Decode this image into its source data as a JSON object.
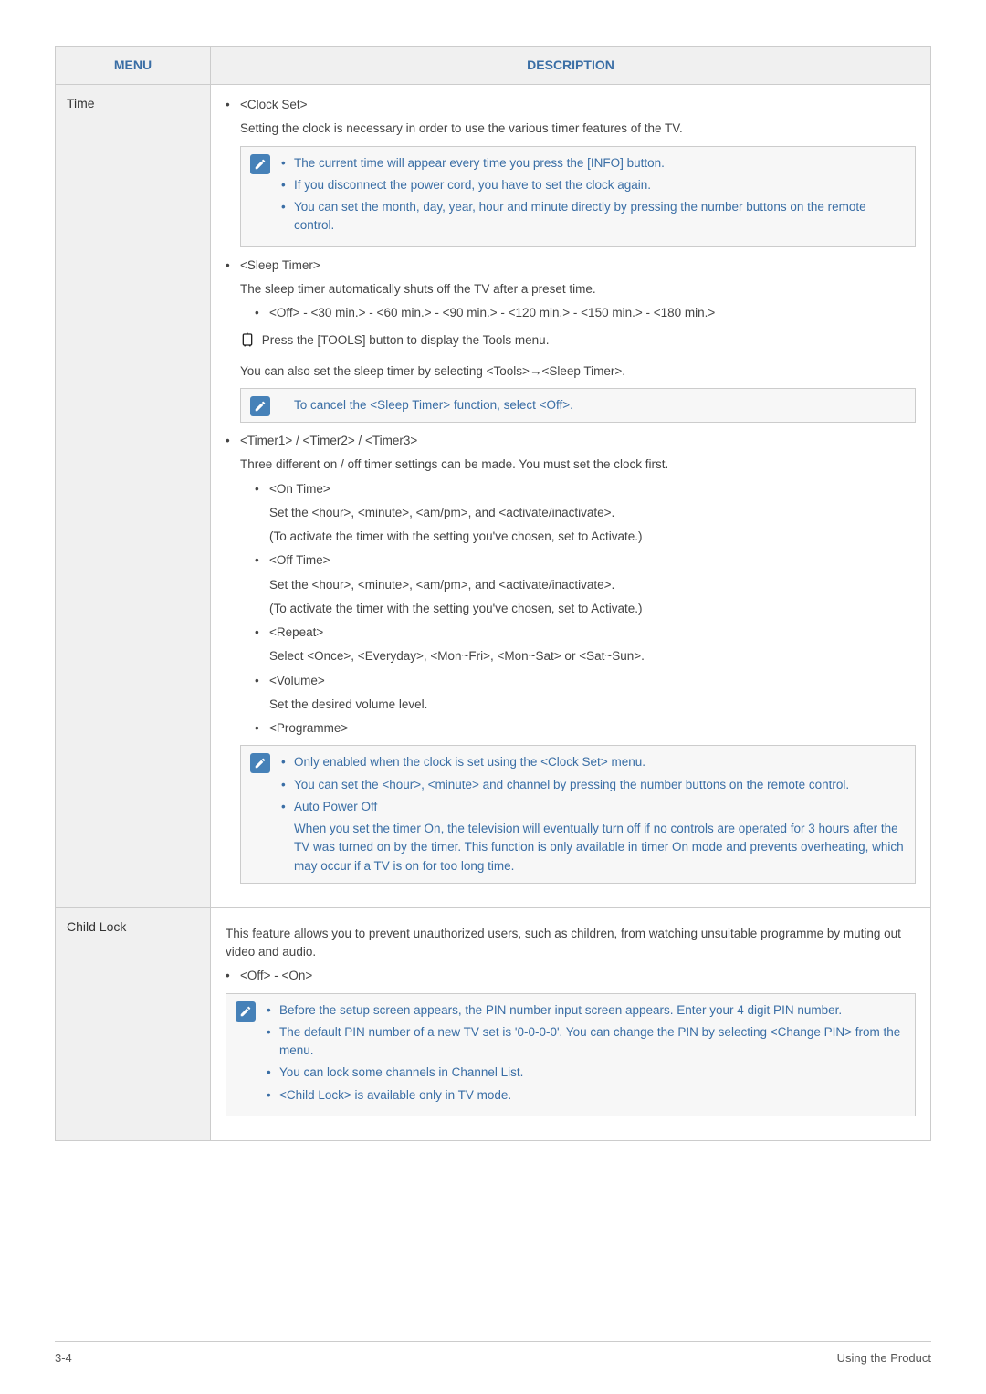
{
  "table": {
    "headers": {
      "menu": "MENU",
      "description": "DESCRIPTION"
    },
    "rows": [
      {
        "menu": "Time",
        "bullets": {
          "clock_set_title": "<Clock Set>",
          "clock_set_desc": "Setting the clock is necessary in order to use the various timer features of the TV.",
          "clock_note_1": "The current time will appear every time you press the [INFO] button.",
          "clock_note_2": "If you disconnect the power cord, you have to set the clock again.",
          "clock_note_3": "You can set the month, day, year, hour and minute directly by pressing the number buttons on the remote control.",
          "sleep_title": "<Sleep Timer>",
          "sleep_desc": "The sleep timer automatically shuts off the TV after a preset time.",
          "sleep_options": "<Off> - <30 min.> - <60 min.> - <90 min.> - <120 min.> - <150 min.> - <180 min.>",
          "tools_line": "Press the [TOOLS] button to display the Tools menu.",
          "tools_also": "You can also set the sleep timer by selecting <Tools>→<Sleep Timer>.",
          "sleep_note": "To cancel the <Sleep Timer> function, select <Off>.",
          "timer_title": "<Timer1> / <Timer2> / <Timer3>",
          "timer_desc": "Three different on / off timer settings can be made. You must set the clock first.",
          "on_time_title": "<On Time>",
          "on_time_desc1": "Set the <hour>, <minute>, <am/pm>, and <activate/inactivate>.",
          "on_time_desc2": "(To activate the timer with the setting you've chosen, set to Activate.)",
          "off_time_title": "<Off Time>",
          "off_time_desc1": "Set the <hour>, <minute>, <am/pm>, and <activate/inactivate>.",
          "off_time_desc2": "(To activate the timer with the setting you've chosen, set to Activate.)",
          "repeat_title": "<Repeat>",
          "repeat_desc": "Select <Once>, <Everyday>, <Mon~Fri>, <Mon~Sat> or <Sat~Sun>.",
          "volume_title": "<Volume>",
          "volume_desc": "Set the desired volume level.",
          "programme_title": "<Programme>",
          "timer_note_1": "Only enabled when the clock is set using the <Clock Set> menu.",
          "timer_note_2": "You can set the <hour>, <minute> and channel by pressing the number buttons on the remote control.",
          "timer_note_3": "Auto Power Off",
          "timer_note_follow": "When you set the timer On, the television will eventually turn off if no controls are operated for 3 hours after the TV was turned on by the timer. This function is only available in timer On mode and prevents overheating, which may occur if a TV is on for too long time."
        }
      },
      {
        "menu": "Child Lock",
        "bullets": {
          "cl_intro": "This feature allows you to prevent unauthorized users, such as children, from watching unsuitable programme by muting out video and audio.",
          "cl_options": "<Off> - <On>",
          "cl_note_1": "Before the setup screen appears, the PIN number input screen appears. Enter your 4 digit PIN number.",
          "cl_note_2": "The default PIN number of a new TV set is '0-0-0-0'. You can change the PIN by selecting <Change PIN> from the menu.",
          "cl_note_3": "You can lock some channels in Channel List.",
          "cl_note_4": "<Child Lock> is available only in TV mode."
        }
      }
    ]
  },
  "footer": {
    "left": "3-4",
    "right": "Using the Product"
  }
}
